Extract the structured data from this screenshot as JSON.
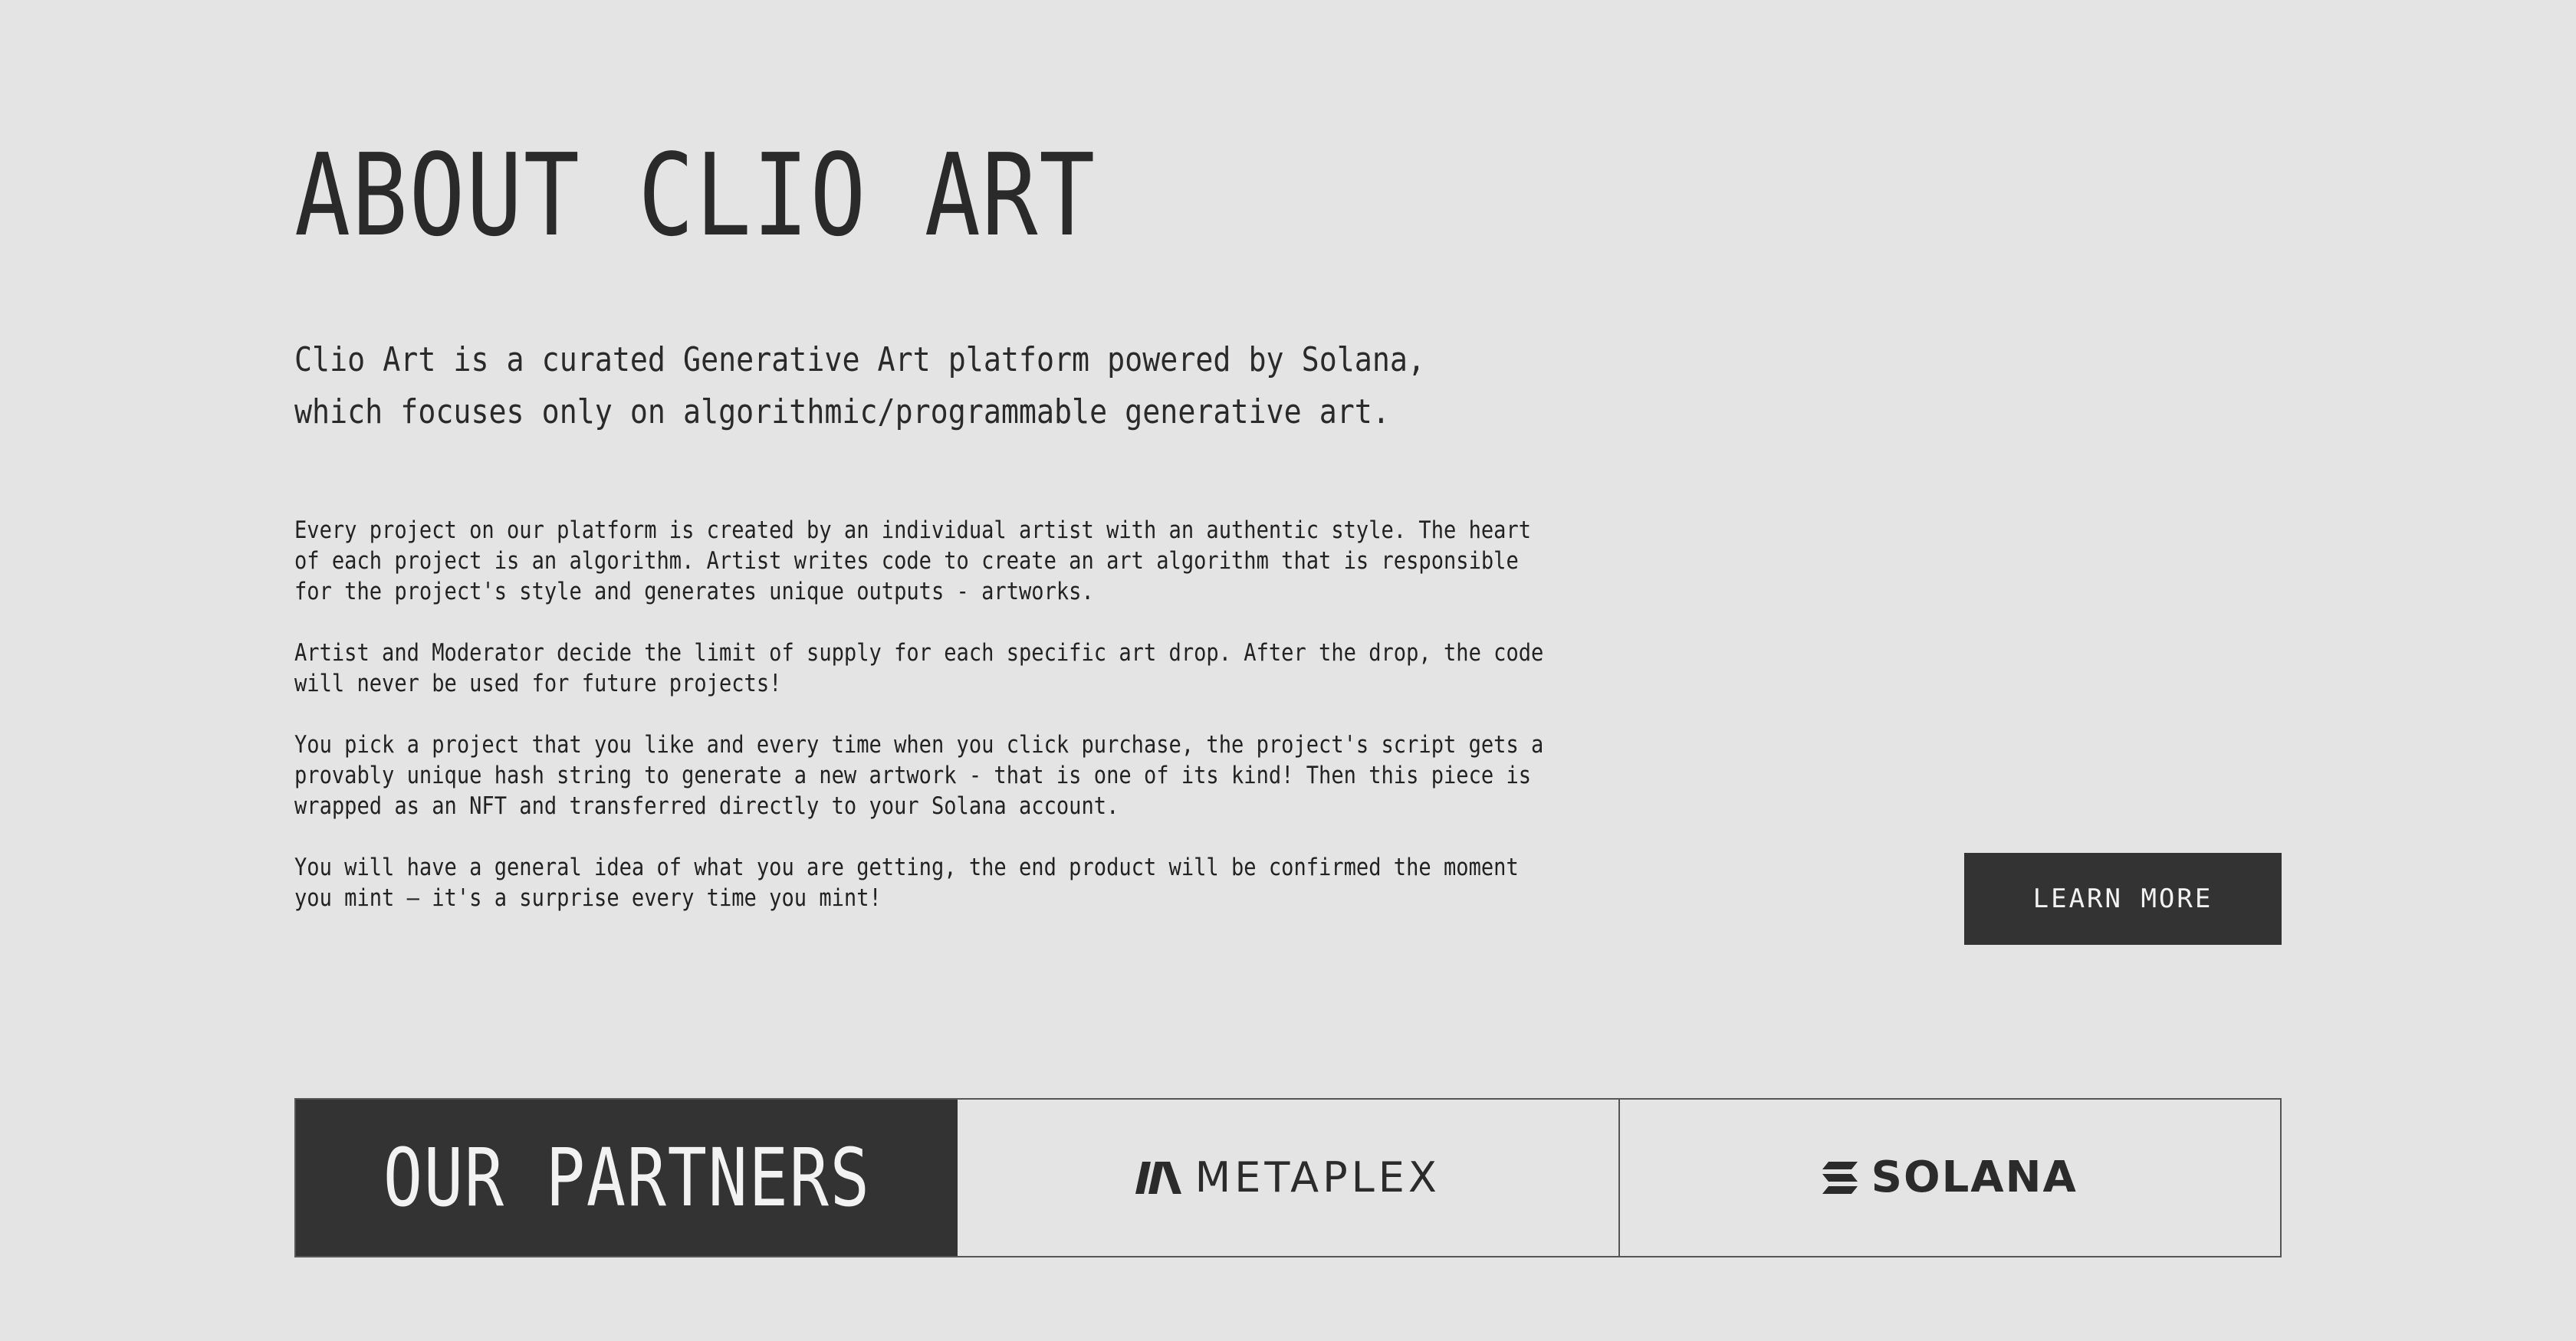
{
  "about": {
    "title": "ABOUT CLIO ART",
    "lead": "Clio Art is a curated Generative Art platform powered by Solana, which focuses only on algorithmic/programmable generative art.",
    "paragraphs": [
      "Every project on our platform is created by an individual artist with an authentic style. The heart of each project is an algorithm. Artist writes code to create an art algorithm that is responsible for the project's style and generates unique outputs - artworks.",
      "Artist and Moderator decide the limit of supply for each specific art drop. After the drop, the code will never be used for future projects!",
      "You pick a project that you like and every time when you click purchase, the project's script gets a provably unique hash string to generate a new artwork - that is one of its kind! Then this piece is wrapped as an NFT and transferred directly to your Solana account.",
      "You will have a general idea of what you are getting, the end product will be confirmed the moment you mint – it's a surprise every time you mint!"
    ],
    "learn_more_label": "LEARN MORE"
  },
  "partners": {
    "heading": "OUR PARTNERS",
    "items": [
      {
        "name": "METAPLEX",
        "icon": "metaplex-logo-icon"
      },
      {
        "name": "SOLANA",
        "icon": "solana-logo-icon"
      }
    ]
  },
  "colors": {
    "background": "#e4e4e4",
    "dark": "#333333",
    "text": "#222222",
    "light_text": "#f2f2f2"
  }
}
